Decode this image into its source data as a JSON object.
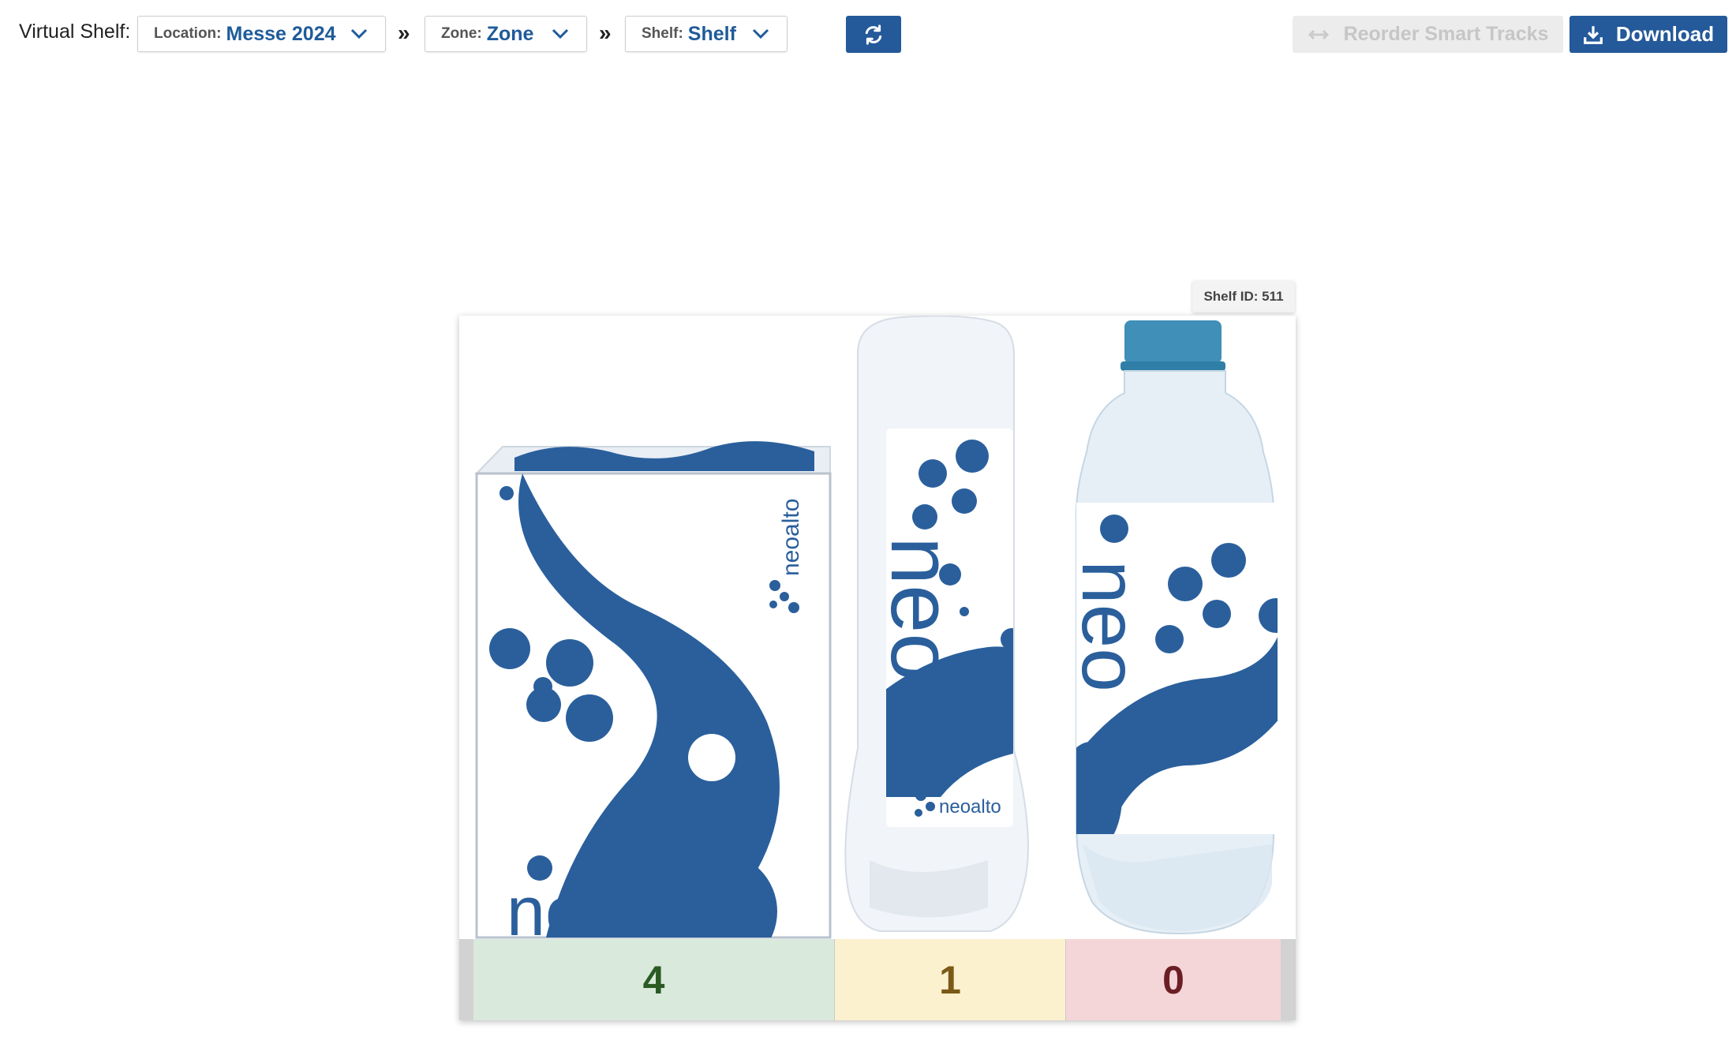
{
  "toolbar": {
    "title": "Virtual Shelf:",
    "location": {
      "label": "Location:",
      "value": "Messe 2024"
    },
    "zone": {
      "label": "Zone:",
      "value": "Zone"
    },
    "shelf": {
      "label": "Shelf:",
      "value": "Shelf"
    },
    "separator": "»",
    "refresh_icon": "refresh-icon",
    "reorder": {
      "label": "Reorder Smart Tracks",
      "icon": "swap-arrows-icon",
      "enabled": false
    },
    "download": {
      "label": "Download",
      "icon": "download-icon"
    }
  },
  "shelf_view": {
    "shelf_id_label": "Shelf ID: 511",
    "products": [
      {
        "name": "box",
        "count": "4",
        "status_color": "#d9eadd"
      },
      {
        "name": "shampoo-bottle",
        "count": "1",
        "status_color": "#fcf1cf"
      },
      {
        "name": "water-bottle",
        "count": "0",
        "status_color": "#f5d6d8"
      }
    ],
    "brand_text": "neoalto"
  },
  "colors": {
    "accent": "#24599a",
    "brand_blue": "#1f5b9a"
  }
}
